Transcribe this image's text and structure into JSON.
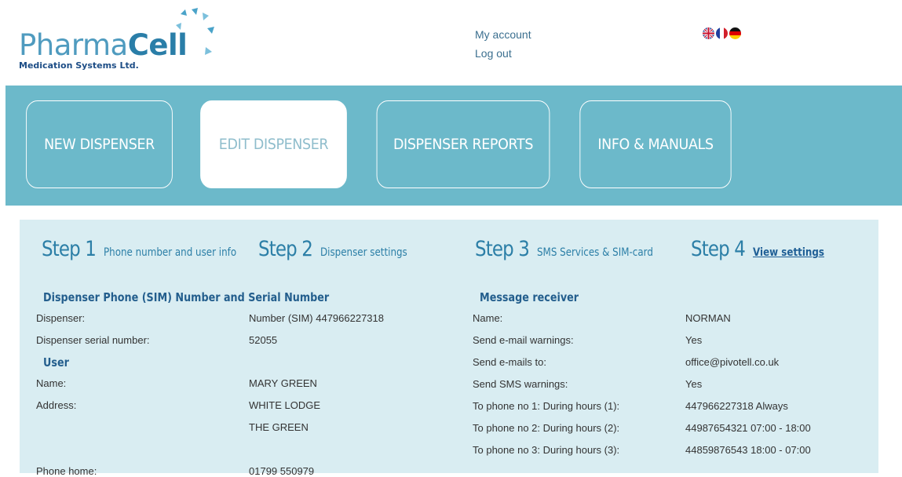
{
  "brand": {
    "name_light": "Pharma",
    "name_bold": "Cell",
    "tagline": "Medication Systems Ltd."
  },
  "account": {
    "my_account": "My account",
    "log_out": "Log out"
  },
  "languages": [
    "uk-flag-icon",
    "fr-flag-icon",
    "de-flag-icon"
  ],
  "nav": {
    "items": [
      {
        "label": "NEW DISPENSER"
      },
      {
        "label": "EDIT DISPENSER",
        "active": true
      },
      {
        "label": "DISPENSER REPORTS"
      },
      {
        "label": "INFO & MANUALS"
      }
    ]
  },
  "steps": [
    {
      "num": "Step 1",
      "text": "Phone number and user info"
    },
    {
      "num": "Step 2",
      "text": "Dispenser settings"
    },
    {
      "num": "Step 3",
      "text": "SMS Services & SIM-card"
    },
    {
      "num": "Step 4",
      "text": "View settings"
    }
  ],
  "dispenser_section": {
    "title": "Dispenser Phone (SIM) Number and Serial Number",
    "rows": [
      {
        "label": "Dispenser:",
        "value": "Number (SIM) 447966227318"
      },
      {
        "label": "Dispenser serial number:",
        "value": "52055"
      }
    ]
  },
  "user_section": {
    "title": "User",
    "name_label": "Name:",
    "name_value": "MARY GREEN",
    "address_label": "Address:",
    "address_line1": "WHITE LODGE",
    "address_line2": "THE GREEN",
    "phone_label": "Phone home:",
    "phone_value": "01799 550979"
  },
  "receiver_section": {
    "title": "Message receiver",
    "rows": [
      {
        "label": "Name:",
        "value": "NORMAN"
      },
      {
        "label": "Send e-mail warnings:",
        "value": "Yes"
      },
      {
        "label": "Send e-mails to:",
        "value": "office@pivotell.co.uk"
      },
      {
        "label": "Send SMS warnings:",
        "value": "Yes"
      },
      {
        "label": "To phone no 1: During hours (1):",
        "value": "447966227318  Always"
      },
      {
        "label": "To phone no 2: During hours (2):",
        "value": "44987654321  07:00 - 18:00"
      },
      {
        "label": "To phone no 3: During hours (3):",
        "value": "44859876543  18:00 - 07:00"
      }
    ]
  },
  "colors": {
    "nav_bg": "#6cb9ca",
    "panel_bg": "#d9edf2",
    "heading_blue": "#2c7fa7",
    "section_blue": "#235e8d"
  }
}
